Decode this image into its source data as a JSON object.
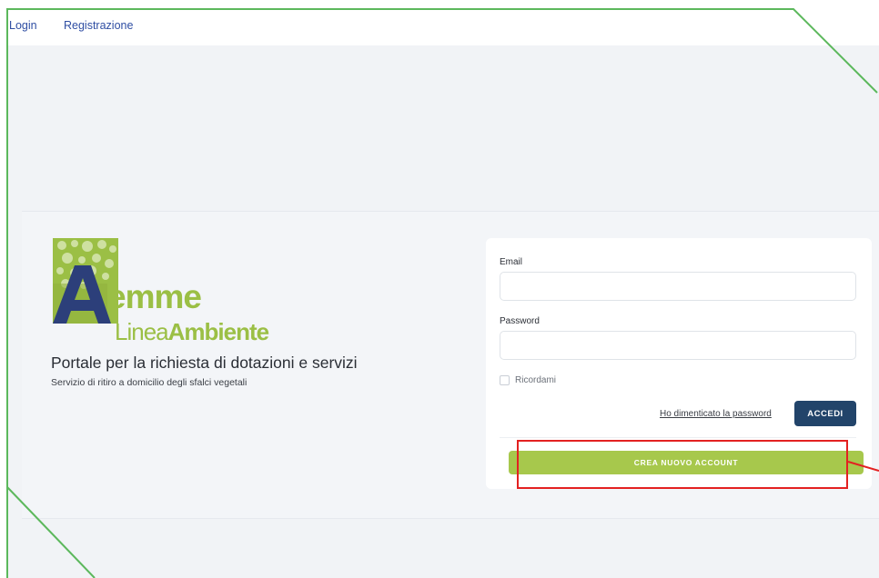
{
  "nav": {
    "login": "Login",
    "register": "Registrazione"
  },
  "logo": {
    "letter": "A",
    "mme": "emme",
    "linea": "Linea",
    "ambiente": "Ambiente",
    "colors": {
      "green": "#9bbf45",
      "navy": "#2c3f7a"
    }
  },
  "intro": {
    "title": "Portale per la richiesta di dotazioni e servizi",
    "subtitle": "Servizio di ritiro a domicilio degli sfalci vegetali"
  },
  "login_form": {
    "email_label": "Email",
    "email_value": "",
    "password_label": "Password",
    "password_value": "",
    "remember_label": "Ricordami",
    "remember_checked": false,
    "forgot_link": "Ho dimenticato la password",
    "submit_label": "ACCEDI",
    "create_account_label": "CREA NUOVO ACCOUNT"
  },
  "colors": {
    "accent_navy": "#22446a",
    "accent_green": "#a7c84c",
    "link_blue": "#2f4ea3",
    "annotation_red": "#e32121",
    "annotation_green": "#5cb85c"
  }
}
